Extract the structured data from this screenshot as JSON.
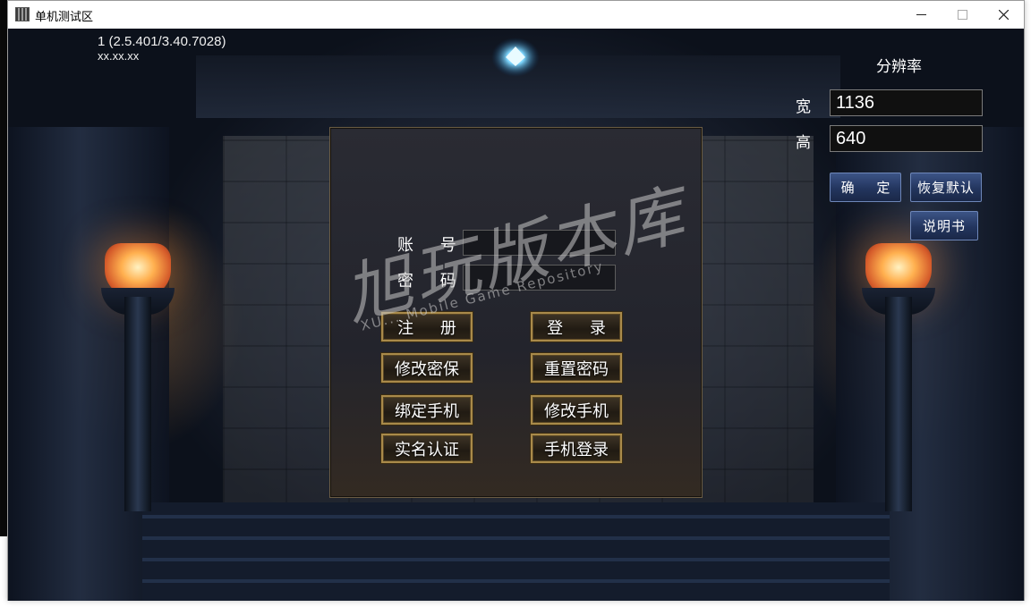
{
  "window": {
    "title": "单机测试区"
  },
  "game": {
    "version": "1 (2.5.401/3.40.7028)",
    "server_ip": "xx.xx.xx"
  },
  "resolution": {
    "title": "分辨率",
    "width_label": "宽",
    "width_value": "1136",
    "height_label": "高",
    "height_value": "640",
    "confirm_label": "确 定",
    "restore_default_label": "恢复默认",
    "manual_label": "说明书"
  },
  "login": {
    "account_label": "账 号",
    "account_value": "",
    "password_label": "密 码",
    "password_value": "",
    "register_label": "注 册",
    "login_label": "登 录",
    "change_security_label": "修改密保",
    "reset_password_label": "重置密码",
    "bind_phone_label": "绑定手机",
    "change_phone_label": "修改手机",
    "real_name_label": "实名认证",
    "phone_login_label": "手机登录"
  },
  "watermark": {
    "cn": "旭玩版本库",
    "en": "XU... Mobile Game Repository"
  },
  "colors": {
    "panel_border": "#6a5c44",
    "gold_button_border": "#a98a4a",
    "blue_button": "#2a3d68",
    "input_bg": "#101010"
  }
}
